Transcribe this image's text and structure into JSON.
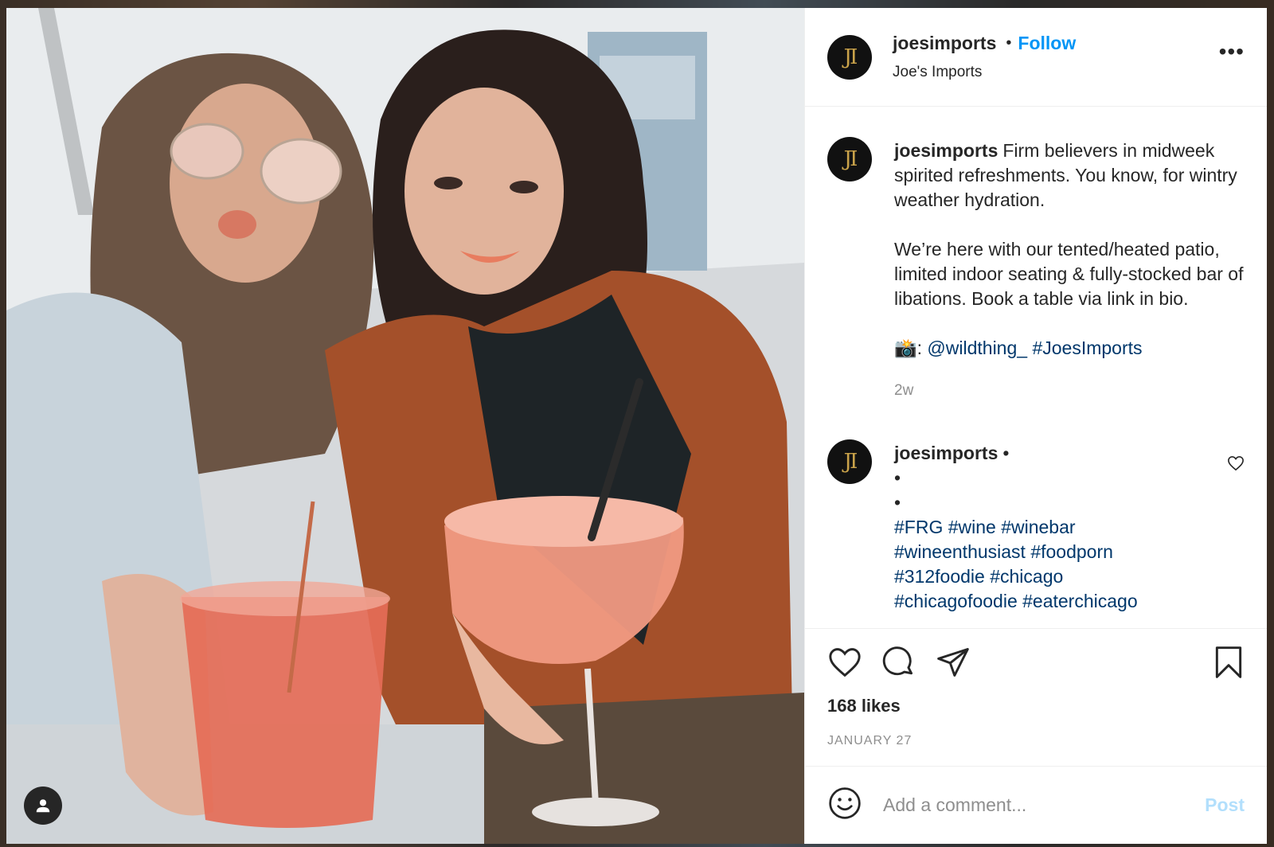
{
  "post": {
    "username": "joesimports",
    "follow_label": "Follow",
    "display_name": "Joe's Imports",
    "avatar_initials": "JI",
    "more_label": "•••"
  },
  "caption": {
    "username": "joesimports",
    "text_1": "Firm believers in midweek spirited refreshments. You know, for wintry weather hydration.",
    "text_2": "We’re here with our tented/heated patio, limited indoor seating & fully-stocked bar of libations. Book a table via link in bio.",
    "credit_prefix": "📸:",
    "credit_mention": "@wildthing_",
    "credit_hashtag": "#JoesImports",
    "time": "2w"
  },
  "comment": {
    "username": "joesimports",
    "dot": "•",
    "line_1": "•",
    "line_2": "•",
    "hashtags_1": "#FRG #wine #winebar",
    "hashtags_2": "#wineenthusiast #foodporn",
    "hashtags_3": "#312foodie #chicago",
    "hashtags_4": "#chicagofoodie #eaterchicago"
  },
  "stats": {
    "likes": "168 likes",
    "date": "JANUARY 27"
  },
  "composer": {
    "placeholder": "Add a comment...",
    "post_label": "Post"
  },
  "colors": {
    "link": "#00376b",
    "follow": "#0095f6",
    "post_disabled": "#b2dffc",
    "gold": "#c9a24a"
  },
  "icons": [
    "user-tag-icon",
    "heart-icon",
    "comment-icon",
    "share-icon",
    "save-icon",
    "emoji-icon",
    "more-icon",
    "heart-small-icon"
  ]
}
